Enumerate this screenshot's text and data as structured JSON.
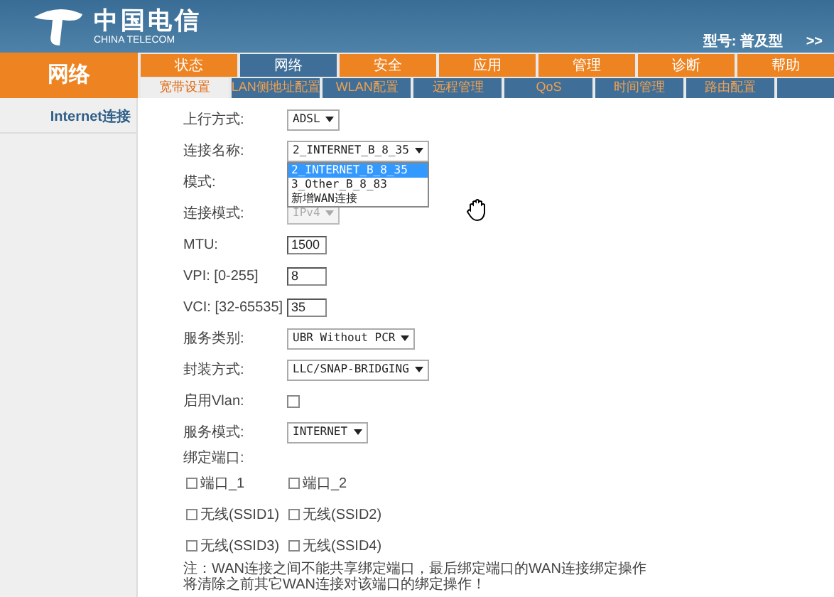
{
  "header": {
    "logo_cn": "中国电信",
    "logo_en": "CHINA TELECOM",
    "model": "型号: 普及型",
    "more": ">>"
  },
  "section": "网络",
  "tabs": [
    {
      "label": "状态",
      "selected": false
    },
    {
      "label": "网络",
      "selected": true
    },
    {
      "label": "安全",
      "selected": false
    },
    {
      "label": "应用",
      "selected": false
    },
    {
      "label": "管理",
      "selected": false
    },
    {
      "label": "诊断",
      "selected": false
    },
    {
      "label": "帮助",
      "selected": false
    }
  ],
  "subtabs": [
    {
      "label": "宽带设置",
      "selected": true
    },
    {
      "label": "LAN侧地址配置",
      "selected": false
    },
    {
      "label": "WLAN配置",
      "selected": false
    },
    {
      "label": "远程管理",
      "selected": false
    },
    {
      "label": "QoS",
      "selected": false
    },
    {
      "label": "时间管理",
      "selected": false
    },
    {
      "label": "路由配置",
      "selected": false
    }
  ],
  "sidebar": {
    "items": [
      {
        "label": "Internet连接",
        "selected": true
      }
    ]
  },
  "form": [
    {
      "kind": "select",
      "label": "上行方式:",
      "value": "ADSL"
    },
    {
      "kind": "select",
      "label": "连接名称:",
      "value": "2_INTERNET_B_8_35",
      "options": [
        {
          "label": "2_INTERNET_B_8_35",
          "selected": true
        },
        {
          "label": "3_Other_B_8_83",
          "selected": false
        },
        {
          "label": "新增WAN连接",
          "selected": false
        }
      ]
    },
    {
      "kind": "text",
      "label": "模式:"
    },
    {
      "kind": "select",
      "label": "连接模式:",
      "value": "IPv4",
      "disabled": true
    },
    {
      "kind": "input",
      "label": "MTU:",
      "value": "1500"
    },
    {
      "kind": "input",
      "label": "VPI: [0-255]",
      "value": "8"
    },
    {
      "kind": "input",
      "label": "VCI: [32-65535]",
      "value": "35"
    },
    {
      "kind": "select",
      "label": "服务类别:",
      "value": "UBR Without PCR"
    },
    {
      "kind": "select",
      "label": "封装方式:",
      "value": "LLC/SNAP-BRIDGING"
    },
    {
      "kind": "checkbox",
      "label": "启用Vlan:",
      "checked": false
    },
    {
      "kind": "select",
      "label": "服务模式:",
      "value": "INTERNET"
    },
    {
      "kind": "text",
      "label": "绑定端口:"
    }
  ],
  "ports": [
    {
      "label": "端口_1",
      "checked": false
    },
    {
      "label": "端口_2",
      "checked": false
    },
    {
      "label": "无线(SSID1)",
      "checked": false
    },
    {
      "label": "无线(SSID2)",
      "checked": false
    },
    {
      "label": "无线(SSID3)",
      "checked": false
    },
    {
      "label": "无线(SSID4)",
      "checked": false
    }
  ],
  "note": "注：WAN连接之间不能共享绑定端口，最后绑定端口的WAN连接绑定操作将清除之前其它WAN连接对该端口的绑定操作！"
}
